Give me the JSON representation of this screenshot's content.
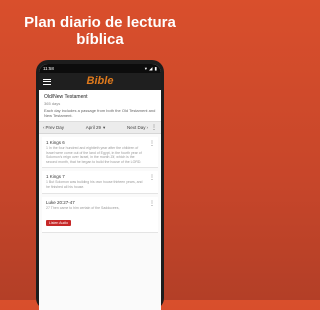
{
  "promo": {
    "line1": "Plan diario de lectura",
    "line2": "bíblica"
  },
  "status": {
    "time": "11:58",
    "wifi_icon": "wifi-icon",
    "signal_icon": "signal-icon",
    "battery_icon": "battery-icon"
  },
  "appbar": {
    "title": "Bible",
    "menu_icon": "menu-icon"
  },
  "plan": {
    "title": "Old/New Testament",
    "duration": "365 days",
    "description": "Each day includes a passage from both the Old Testament and New Testament."
  },
  "nav": {
    "prev": "Prev Day",
    "date": "April 29",
    "next": "Next Day"
  },
  "readings": [
    {
      "ref": "1 Kings 6",
      "text": "1 In the four hundred and eightieth year after the children of Israel were come out of the land of Egypt, in the fourth year of Solomon's reign over Israel, in the month Zif, which is the second month, that he began to build the house of the LORD."
    },
    {
      "ref": "1 Kings 7",
      "text": "1 But Solomon was building his own house thirteen years, and he finished all his house."
    },
    {
      "ref": "Luke 20:27-47",
      "text": "27 Then came to him certain of the Sadducees,",
      "action": "Listen Audio"
    }
  ]
}
